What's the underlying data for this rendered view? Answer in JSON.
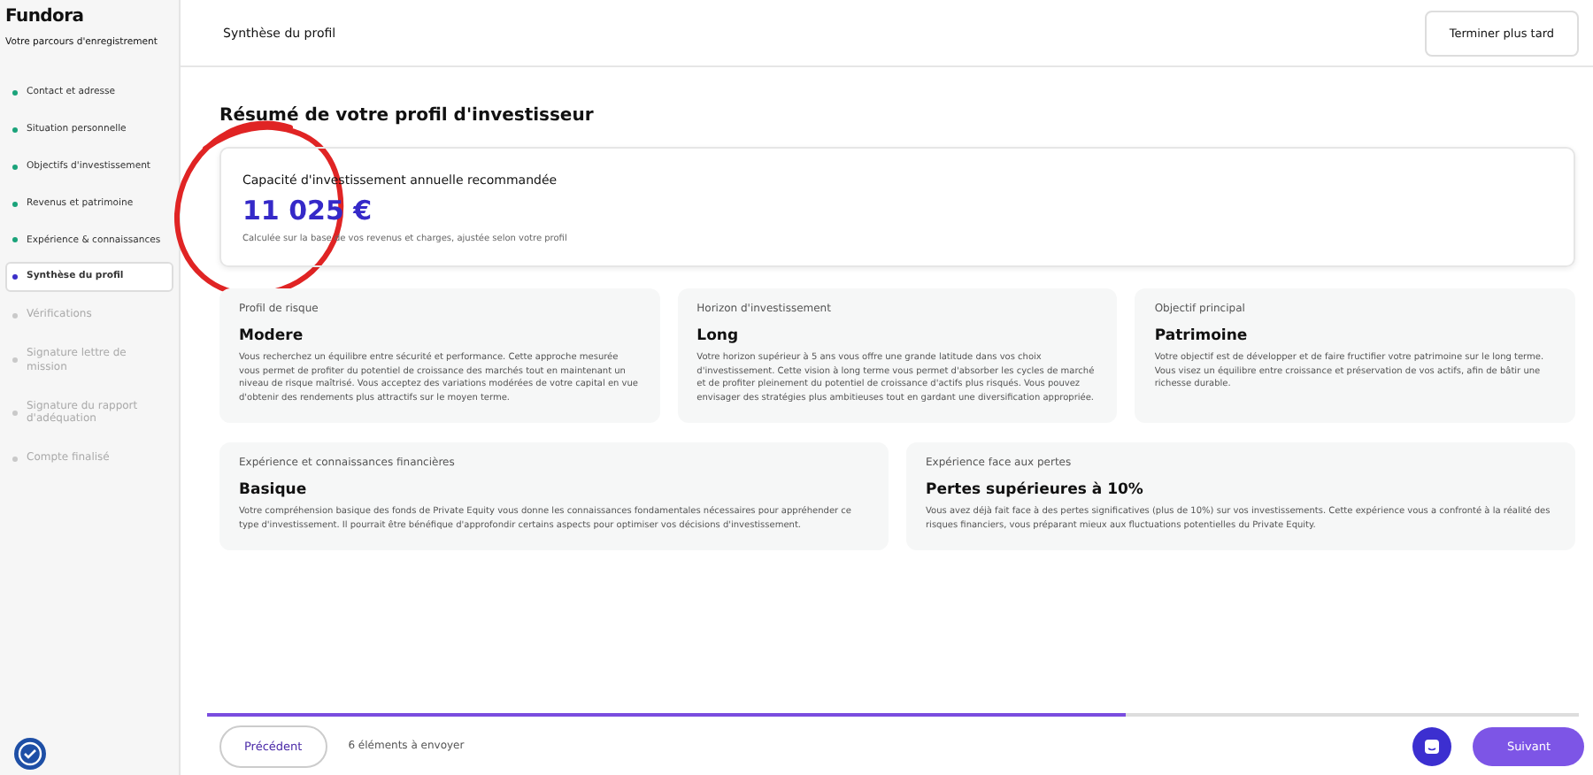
{
  "sidebar": {
    "logo": "Fundora",
    "subtitle": "Votre parcours d'enregistrement",
    "steps": [
      {
        "label": "Contact et adresse",
        "completed": true,
        "selected": false
      },
      {
        "label": "Situation personnelle",
        "completed": true,
        "selected": false
      },
      {
        "label": "Objectifs d'investissement",
        "completed": true,
        "selected": false
      },
      {
        "label": "Revenus et patrimoine",
        "completed": true,
        "selected": false
      },
      {
        "label": "Expérience & connaissances",
        "completed": true,
        "selected": false
      },
      {
        "label": "Synthèse du profil",
        "completed": false,
        "selected": true
      },
      {
        "label": "Vérifications",
        "completed": false,
        "selected": false
      },
      {
        "label": "Signature lettre de mission",
        "completed": false,
        "selected": false
      },
      {
        "label": "Signature du rapport d'adéquation",
        "completed": false,
        "selected": false
      },
      {
        "label": "Compte finalisé",
        "completed": false,
        "selected": false
      }
    ]
  },
  "header": {
    "title": "Synthèse du profil",
    "button": "Terminer plus tard"
  },
  "page_title": "Résumé de votre profil d'investisseur",
  "capacity": {
    "label": "Capacité d'investissement annuelle recommandée",
    "amount": "11 025 €",
    "note": "Calculée sur la base de vos revenus et charges, ajustée selon votre profil"
  },
  "cards_row_1": [
    {
      "label": "Profil de risque",
      "value": "Modere",
      "text": "Vous recherchez un équilibre entre sécurité et performance. Cette approche mesurée vous permet de profiter du potentiel de croissance des marchés tout en maintenant un niveau de risque maîtrisé. Vous acceptez des variations modérées de votre capital en vue d'obtenir des rendements plus attractifs sur le moyen terme."
    },
    {
      "label": "Horizon d'investissement",
      "value": "Long",
      "text": "Votre horizon supérieur à 5 ans vous offre une grande latitude dans vos choix d'investissement. Cette vision à long terme vous permet d'absorber les cycles de marché et de profiter pleinement du potentiel de croissance d'actifs plus risqués. Vous pouvez envisager des stratégies plus ambitieuses tout en gardant une diversification appropriée."
    },
    {
      "label": "Objectif principal",
      "value": "Patrimoine",
      "text": "Votre objectif est de développer et de faire fructifier votre patrimoine sur le long terme. Vous visez un équilibre entre croissance et préservation de vos actifs, afin de bâtir une richesse durable."
    }
  ],
  "cards_row_2": [
    {
      "label": "Expérience et connaissances financières",
      "value": "Basique",
      "text": "Votre compréhension basique des fonds de Private Equity vous donne les connaissances fondamentales nécessaires pour appréhender ce type d'investissement. Il pourrait être bénéfique d'approfondir certains aspects pour optimiser vos décisions d'investissement."
    },
    {
      "label": "Expérience face aux pertes",
      "value": "Pertes supérieures à 10%",
      "text": "Vous avez déjà fait face à des pertes significatives (plus de 10%) sur vos investissements. Cette expérience vous a confronté à la réalité des risques financiers, vous préparant mieux aux fluctuations potentielles du Private Equity."
    }
  ],
  "progress": {
    "level": 0.67
  },
  "footer": {
    "previous": "Précédent",
    "pending": "6 éléments à envoyer",
    "next": "Suivant"
  }
}
